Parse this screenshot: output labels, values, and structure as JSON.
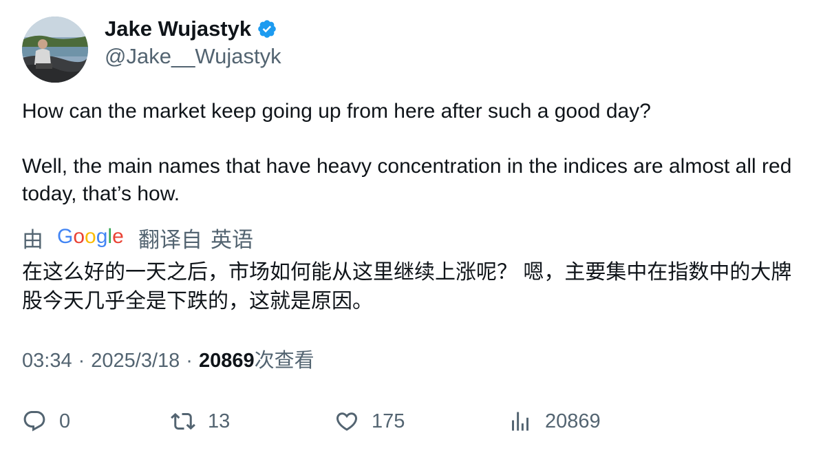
{
  "author": {
    "display_name": "Jake Wujastyk",
    "handle": "@Jake__Wujastyk",
    "verified": true,
    "avatar_icon": "profile-photo"
  },
  "tweet": {
    "paragraphs": [
      "How can the market keep going up from here after such a good day?",
      "Well, the main names that have heavy concentration in the indices are almost all red today, that’s how."
    ]
  },
  "translation": {
    "by_label": "由",
    "provider": "Google",
    "from_label": "翻译自",
    "language": "英语",
    "text": "在这么好的一天之后，市场如何能从这里继续上涨呢？ 嗯，主要集中在指数中的大牌股今天几乎全是下跌的，这就是原因。"
  },
  "meta": {
    "time": "03:34",
    "date": "2025/3/18",
    "separator": "·",
    "views_count": "20869",
    "views_label": "次查看"
  },
  "actions": {
    "reply_count": "0",
    "retweet_count": "13",
    "like_count": "175",
    "views_count": "20869"
  },
  "colors": {
    "text": "#0f1419",
    "secondary": "#536471",
    "verified_blue": "#1d9bf0",
    "google_blue": "#4285F4",
    "google_red": "#EA4335",
    "google_yellow": "#FBBC05",
    "google_green": "#34A853"
  }
}
